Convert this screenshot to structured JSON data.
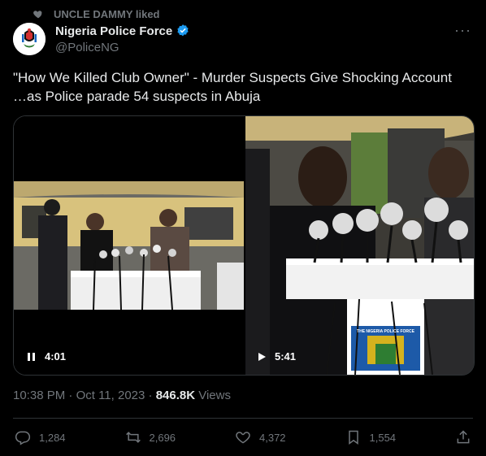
{
  "social_context": {
    "text": "UNCLE DAMMY liked",
    "icon": "heart-icon"
  },
  "author": {
    "name": "Nigeria Police Force",
    "handle": "@PoliceNG",
    "verified": true,
    "avatar_icon": "police-crest-logo"
  },
  "more_icon": "more-options-icon",
  "tweet": {
    "line1": "\"How We Killed Club Owner\" - Murder Suspects Give Shocking Account",
    "line2": "…as Police parade 54 suspects in Abuja"
  },
  "videos": [
    {
      "duration": "4:01",
      "state": "paused",
      "control_icon": "pause-icon"
    },
    {
      "duration": "5:41",
      "state": "stopped",
      "control_icon": "play-icon",
      "podium_sign": "THE NIGERIA POLICE FORCE"
    }
  ],
  "meta": {
    "time": "10:38 PM",
    "date": "Oct 11, 2023",
    "views_count": "846.8K",
    "views_label": "Views"
  },
  "actions": {
    "replies": "1,284",
    "reposts": "2,696",
    "likes": "4,372",
    "bookmarks": "1,554"
  },
  "colors": {
    "background": "#000000",
    "text": "#e7e9ea",
    "secondary": "#71767b",
    "verified": "#1d9bf0",
    "border": "#2f3336"
  }
}
